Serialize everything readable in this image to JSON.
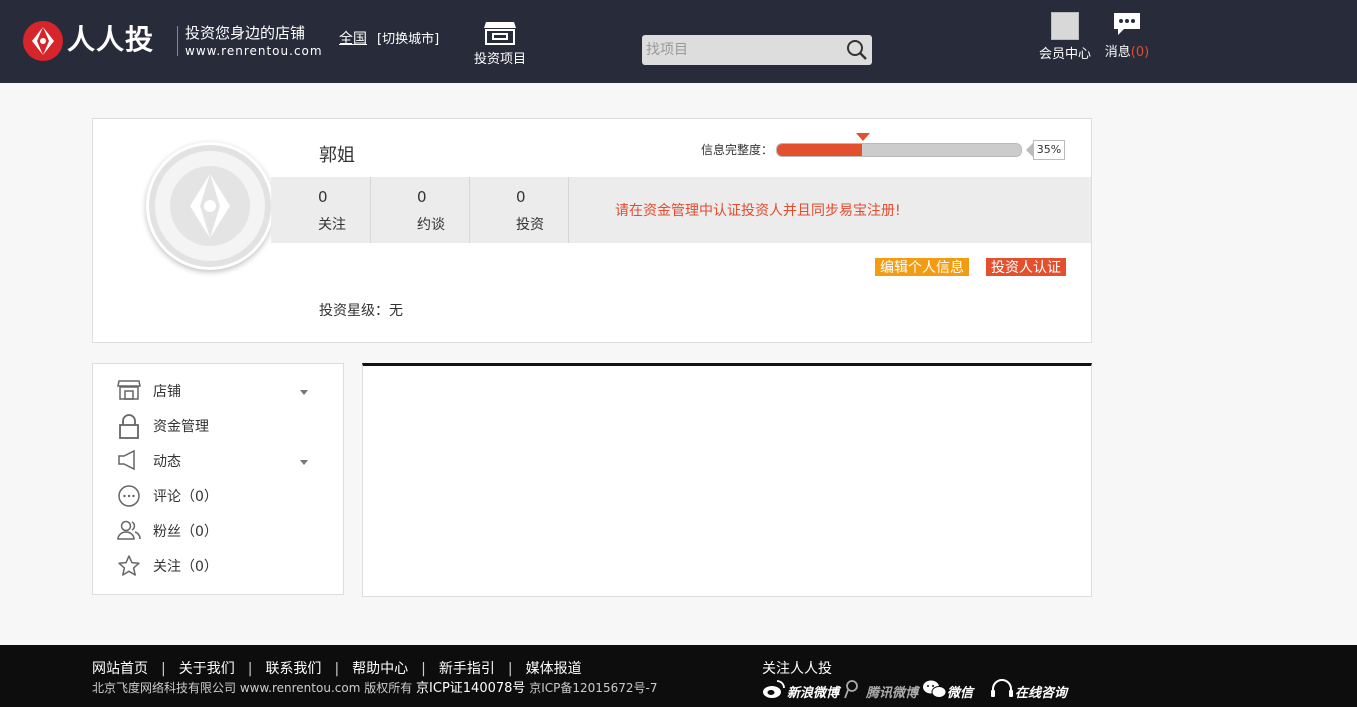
{
  "header": {
    "brand_name": "人人投",
    "slogan": "投资您身边的店铺",
    "domain": "www.renrentou.com",
    "city": "全国",
    "city_switch": "[切换城市]",
    "nav_invest": "投资项目",
    "search_placeholder": "找项目",
    "member_center": "会员中心",
    "messages_label": "消息",
    "messages_count": "(0)"
  },
  "profile": {
    "name": "郭姐",
    "completeness_label": "信息完整度：",
    "completeness_percent": 35,
    "completeness_text": "35%",
    "stats": [
      {
        "value": "0",
        "label": "关注"
      },
      {
        "value": "0",
        "label": "约谈"
      },
      {
        "value": "0",
        "label": "投资"
      }
    ],
    "notice": "请在资金管理中认证投资人并且同步易宝注册!",
    "edit_button": "编辑个人信息",
    "certify_button": "投资人认证",
    "star_level": "投资星级：无"
  },
  "sidebar": {
    "items": [
      {
        "label": "店铺",
        "icon": "store-icon"
      },
      {
        "label": "资金管理",
        "icon": "lock-icon"
      },
      {
        "label": "动态",
        "icon": "megaphone-icon"
      },
      {
        "label": "评论（0）",
        "icon": "comment-icon"
      },
      {
        "label": "粉丝（0）",
        "icon": "fans-icon"
      },
      {
        "label": "关注（0）",
        "icon": "star-icon"
      }
    ]
  },
  "footer": {
    "links": [
      "网站首页",
      "关于我们",
      "联系我们",
      "帮助中心",
      "新手指引",
      "媒体报道"
    ],
    "copyright": "北京飞度网络科技有限公司 www.renrentou.com 版权所有",
    "icp_license": "京ICP证140078号",
    "icp_record": "京ICP备12015672号-7",
    "follow_title": "关注人人投",
    "social": [
      "新浪微博",
      "腾讯微博",
      "微信",
      "在线咨询"
    ]
  },
  "colors": {
    "header_bg": "#282b3a",
    "accent_red": "#e2502d",
    "accent_orange": "#f39c12",
    "footer_bg": "#0d0d0d"
  }
}
